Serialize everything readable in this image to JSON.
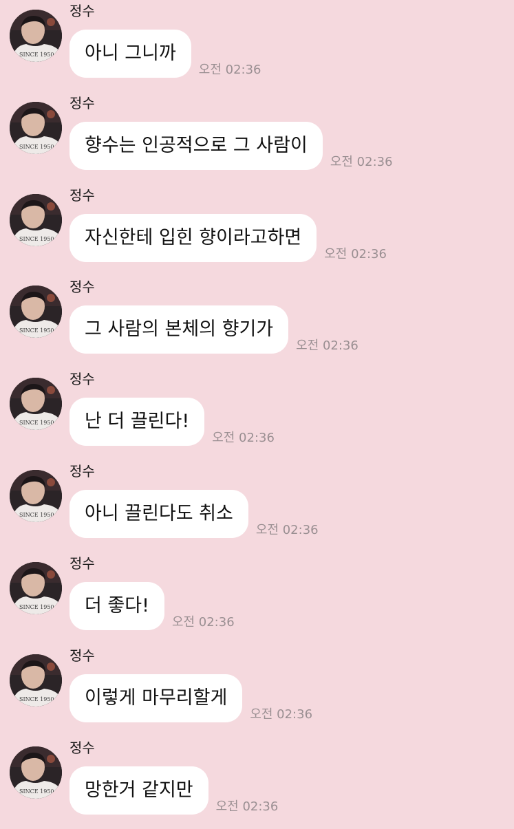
{
  "colors": {
    "background": "#f5d9de",
    "bubble": "#ffffff",
    "time_text": "#9a8f92"
  },
  "messages": [
    {
      "sender": "정수",
      "text": "아니 그니까",
      "time": "오전 02:36"
    },
    {
      "sender": "정수",
      "text": "향수는 인공적으로 그 사람이",
      "time": "오전 02:36"
    },
    {
      "sender": "정수",
      "text": "자신한테 입힌 향이라고하면",
      "time": "오전 02:36"
    },
    {
      "sender": "정수",
      "text": "그 사람의 본체의 향기가",
      "time": "오전 02:36"
    },
    {
      "sender": "정수",
      "text": "난 더 끌린다!",
      "time": "오전 02:36"
    },
    {
      "sender": "정수",
      "text": "아니 끌린다도 취소",
      "time": "오전 02:36"
    },
    {
      "sender": "정수",
      "text": "더 좋다!",
      "time": "오전 02:36"
    },
    {
      "sender": "정수",
      "text": "이렇게 마무리할게",
      "time": "오전 02:36"
    },
    {
      "sender": "정수",
      "text": "망한거 같지만",
      "time": "오전 02:36"
    }
  ]
}
